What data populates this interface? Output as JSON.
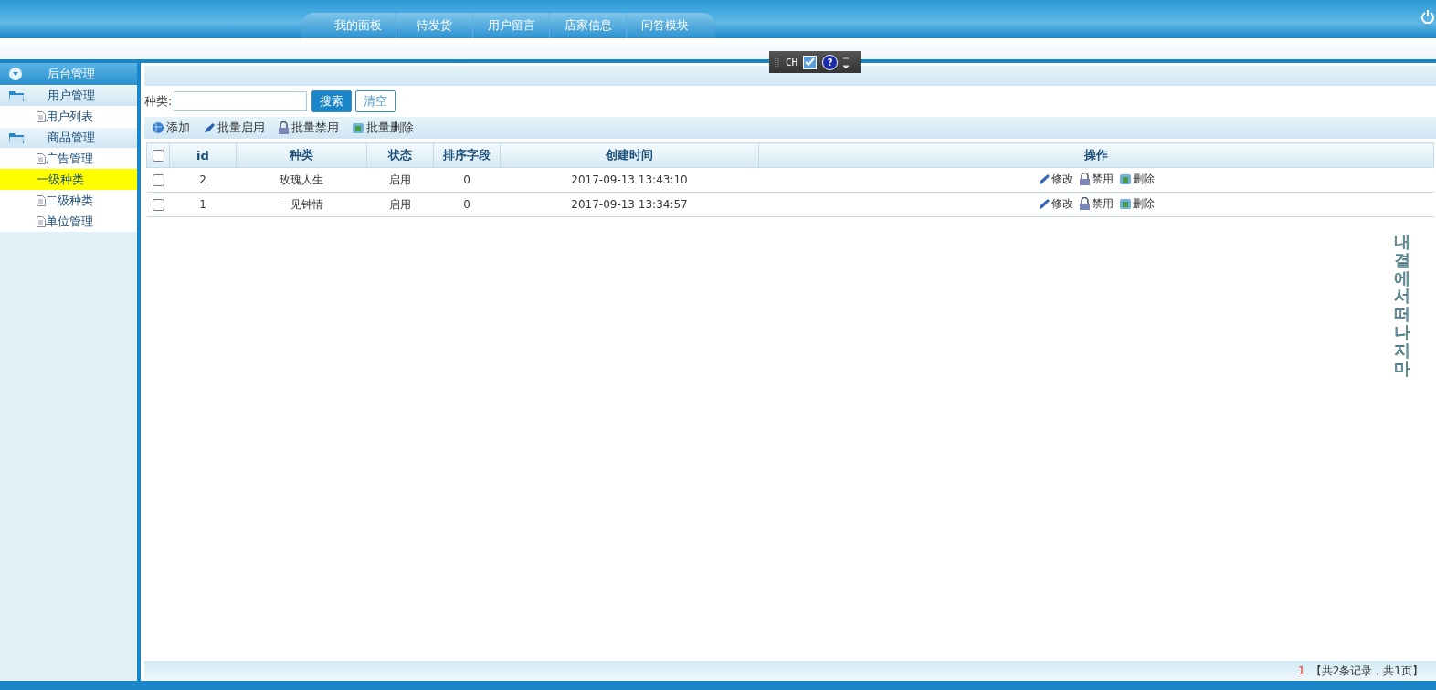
{
  "top_nav": [
    {
      "label": "我的面板",
      "selected": false
    },
    {
      "label": "待发货",
      "selected": false
    },
    {
      "label": "用户留言",
      "selected": false
    },
    {
      "label": "店家信息",
      "selected": false
    },
    {
      "label": "问答模块",
      "selected": false
    }
  ],
  "ime_bar": {
    "label": "CH",
    "help": "?"
  },
  "sidebar": {
    "title": "后台管理",
    "groups": [
      {
        "label": "用户管理",
        "expanded": true,
        "children": [
          {
            "label": "用户列表",
            "selected": false
          }
        ]
      },
      {
        "label": "商品管理",
        "expanded": true,
        "children": [
          {
            "label": "广告管理",
            "selected": false
          },
          {
            "label": "一级种类",
            "selected": true
          },
          {
            "label": "二级种类",
            "selected": false
          },
          {
            "label": "单位管理",
            "selected": false
          }
        ]
      }
    ]
  },
  "search": {
    "label": "种类:",
    "search_button": "搜索",
    "clear_button": "清空"
  },
  "toolbar": [
    {
      "kind": "add",
      "label": "添加"
    },
    {
      "kind": "enable",
      "label": "批量启用"
    },
    {
      "kind": "disable",
      "label": "批量禁用"
    },
    {
      "kind": "delete",
      "label": "批量删除"
    }
  ],
  "table": {
    "select_all_checked": false,
    "columns": [
      "id",
      "种类",
      "状态",
      "排序字段",
      "创建时间",
      "操作"
    ],
    "rows": [
      {
        "checked": false,
        "cells": [
          "2",
          "玫瑰人生",
          "启用",
          "0",
          "2017-09-13 13:43:10"
        ],
        "actions": [
          {
            "kind": "edit",
            "label": "修改"
          },
          {
            "kind": "disable",
            "label": "禁用"
          },
          {
            "kind": "delete",
            "label": "删除"
          }
        ]
      },
      {
        "checked": false,
        "cells": [
          "1",
          "一见钟情",
          "启用",
          "0",
          "2017-09-13 13:34:57"
        ],
        "actions": [
          {
            "kind": "edit",
            "label": "修改"
          },
          {
            "kind": "disable",
            "label": "禁用"
          },
          {
            "kind": "delete",
            "label": "删除"
          }
        ]
      }
    ]
  },
  "lyric_overlay": "내 곁에서 떠나지마",
  "pager": {
    "current": "1",
    "summary": "【共2条记录，共1页】"
  }
}
